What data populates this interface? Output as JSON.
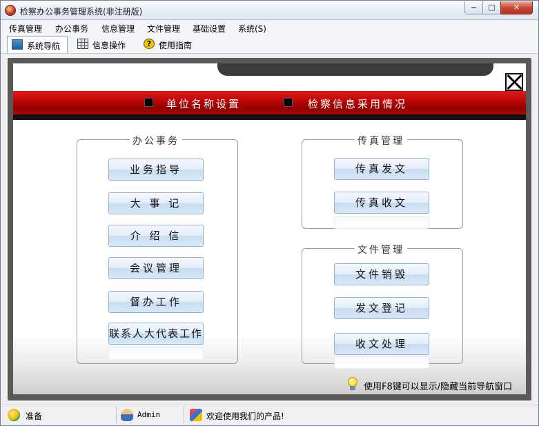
{
  "window": {
    "title": "检察办公事务管理系统(非注册版)",
    "controls": {
      "minimize": "−",
      "maximize": "□",
      "close": "✕"
    }
  },
  "menu": [
    "传真管理",
    "办公事务",
    "信息管理",
    "文件管理",
    "基础设置",
    "系统(S)"
  ],
  "toolbar": {
    "tabs": [
      {
        "label": "系统导航",
        "icon": "monitor-icon",
        "active": true
      },
      {
        "label": "信息操作",
        "icon": "grid-icon",
        "active": false
      },
      {
        "label": "使用指南",
        "icon": "help-icon",
        "active": false
      }
    ]
  },
  "banner": {
    "items": [
      "单位名称设置",
      "检察信息采用情况"
    ],
    "color_top": "#e11a17",
    "color_bottom": "#8e0000"
  },
  "groups": {
    "office": {
      "title": "办公事务",
      "buttons": [
        "业务指导",
        "大 事 记",
        "介 绍 信",
        "会议管理",
        "督办工作",
        "联系人大代表工作"
      ]
    },
    "fax": {
      "title": "传真管理",
      "buttons": [
        "传真发文",
        "传真收文"
      ]
    },
    "file": {
      "title": "文件管理",
      "buttons": [
        "文件销毁",
        "发文登记",
        "收文处理"
      ]
    }
  },
  "hint": {
    "text": "使用F8键可以显示/隐藏当前导航窗口",
    "icon": "lightbulb-icon"
  },
  "status": {
    "ready": "准备",
    "user": "Admin",
    "message": "欢迎使用我们的产品!"
  }
}
